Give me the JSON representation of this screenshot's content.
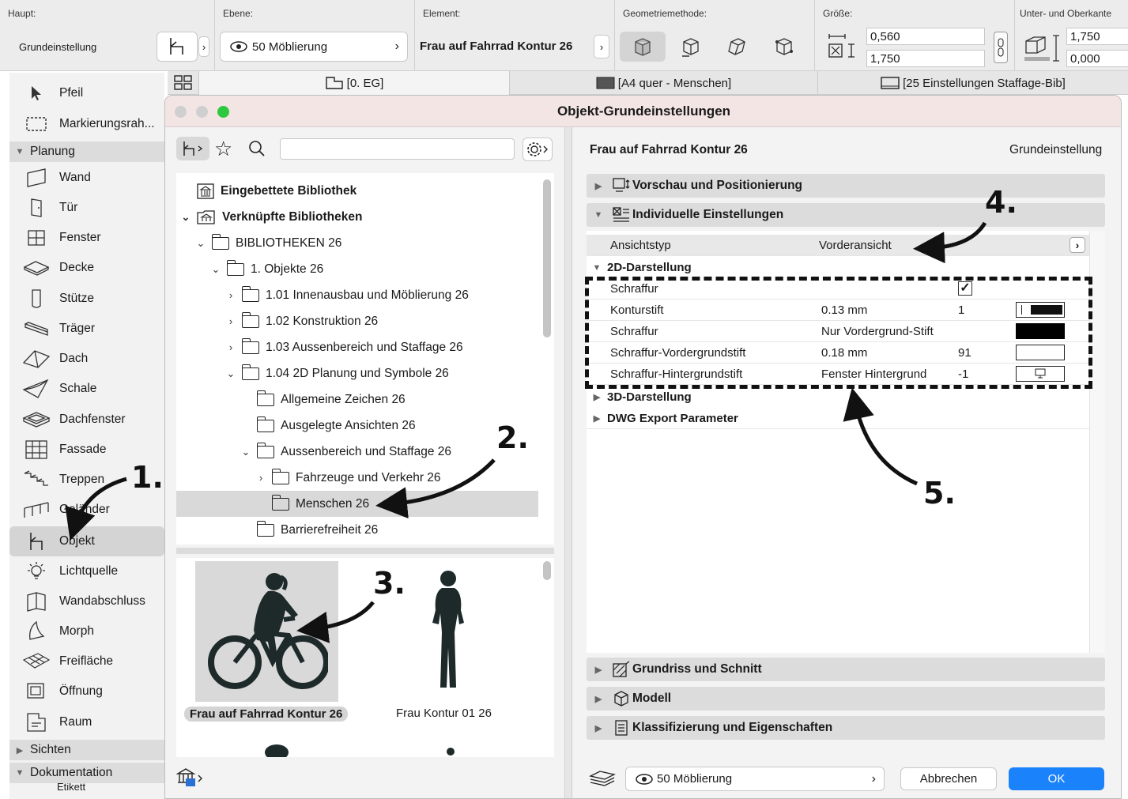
{
  "toolbar": {
    "haupt_label": "Haupt:",
    "haupt_value": "Grundeinstellung",
    "ebene_label": "Ebene:",
    "ebene_value": "50 Möblierung",
    "element_label": "Element:",
    "element_value": "Frau auf Fahrrad Kontur 26",
    "geometrie_label": "Geometriemethode:",
    "groesse_label": "Größe:",
    "groesse_w": "0,560",
    "groesse_h": "1,750",
    "kante_label": "Unter- und Oberkante",
    "kante_top": "1,750",
    "kante_bottom": "0,000"
  },
  "tabs": [
    {
      "label": "[0. EG]"
    },
    {
      "label": "[A4 quer - Menschen]"
    },
    {
      "label": "[25 Einstellungen Staffage-Bib]"
    }
  ],
  "palette": {
    "items": [
      {
        "label": "Pfeil",
        "icon": "arrow-pointer-icon"
      },
      {
        "label": "Markierungsrah...",
        "icon": "marquee-icon"
      },
      {
        "label": "Wand",
        "icon": "wall-icon"
      },
      {
        "label": "Tür",
        "icon": "door-icon"
      },
      {
        "label": "Fenster",
        "icon": "window-icon"
      },
      {
        "label": "Decke",
        "icon": "slab-icon"
      },
      {
        "label": "Stütze",
        "icon": "column-icon"
      },
      {
        "label": "Träger",
        "icon": "beam-icon"
      },
      {
        "label": "Dach",
        "icon": "roof-icon"
      },
      {
        "label": "Schale",
        "icon": "shell-icon"
      },
      {
        "label": "Dachfenster",
        "icon": "skylight-icon"
      },
      {
        "label": "Fassade",
        "icon": "curtain-wall-icon"
      },
      {
        "label": "Treppen",
        "icon": "stair-icon"
      },
      {
        "label": "Geländer",
        "icon": "railing-icon"
      },
      {
        "label": "Objekt",
        "icon": "object-chair-icon"
      },
      {
        "label": "Lichtquelle",
        "icon": "lamp-icon"
      },
      {
        "label": "Wandabschluss",
        "icon": "wall-end-icon"
      },
      {
        "label": "Morph",
        "icon": "morph-icon"
      },
      {
        "label": "Freifläche",
        "icon": "mesh-icon"
      },
      {
        "label": "Öffnung",
        "icon": "opening-icon"
      },
      {
        "label": "Raum",
        "icon": "zone-icon"
      },
      {
        "label": "Etikett",
        "icon": "label-icon"
      }
    ],
    "group_planung": "Planung",
    "group_sichten": "Sichten",
    "group_dokumentation": "Dokumentation"
  },
  "dialog": {
    "title": "Objekt-Grundeinstellungen",
    "search_placeholder": "",
    "tree": [
      {
        "label": "Eingebettete Bibliothek"
      },
      {
        "label": "Verknüpfte Bibliotheken"
      },
      {
        "label": "BIBLIOTHEKEN 26"
      },
      {
        "label": "1. Objekte 26"
      },
      {
        "label": "1.01 Innenausbau und Möblierung 26"
      },
      {
        "label": "1.02 Konstruktion 26"
      },
      {
        "label": "1.03 Aussenbereich und Staffage 26"
      },
      {
        "label": "1.04 2D Planung und Symbole 26"
      },
      {
        "label": "Allgemeine Zeichen 26"
      },
      {
        "label": "Ausgelegte Ansichten 26"
      },
      {
        "label": "Aussenbereich und Staffage 26"
      },
      {
        "label": "Fahrzeuge und Verkehr 26"
      },
      {
        "label": "Menschen 26"
      },
      {
        "label": "Barrierefreiheit 26"
      }
    ],
    "thumbnails": [
      {
        "label": "Frau auf Fahrrad Kontur 26"
      },
      {
        "label": "Frau Kontur 01 26"
      }
    ],
    "element_name": "Frau auf Fahrrad Kontur 26",
    "element_status": "Grundeinstellung",
    "sections": {
      "vorschau": "Vorschau und Positionierung",
      "individuell": "Individuelle Einstellungen",
      "grundriss": "Grundriss und Schnitt",
      "modell": "Modell",
      "klassifizierung": "Klassifizierung und Eigenschaften"
    },
    "ansichtstyp_label": "Ansichtstyp",
    "ansichtstyp_value": "Vorderansicht",
    "group_2d": "2D-Darstellung",
    "group_3d": "3D-Darstellung",
    "group_dwg": "DWG Export Parameter",
    "params": [
      {
        "name": "Schraffur",
        "value": "",
        "num": ""
      },
      {
        "name": "Konturstift",
        "value": "0.13 mm",
        "num": "1"
      },
      {
        "name": "Schraffur",
        "value": "Nur Vordergrund-Stift",
        "num": ""
      },
      {
        "name": "Schraffur-Vordergrundstift",
        "value": "0.18 mm",
        "num": "91"
      },
      {
        "name": "Schraffur-Hintergrundstift",
        "value": "Fenster Hintergrund",
        "num": "-1"
      }
    ],
    "layer_value": "50 Möblierung",
    "cancel_label": "Abbrechen",
    "ok_label": "OK"
  },
  "annotations": [
    "1.",
    "2.",
    "3.",
    "4.",
    "5."
  ],
  "colors": {
    "accent": "#1a82fb",
    "close_dot": "#cfcfcf",
    "zoom_dot": "#2ec840"
  }
}
